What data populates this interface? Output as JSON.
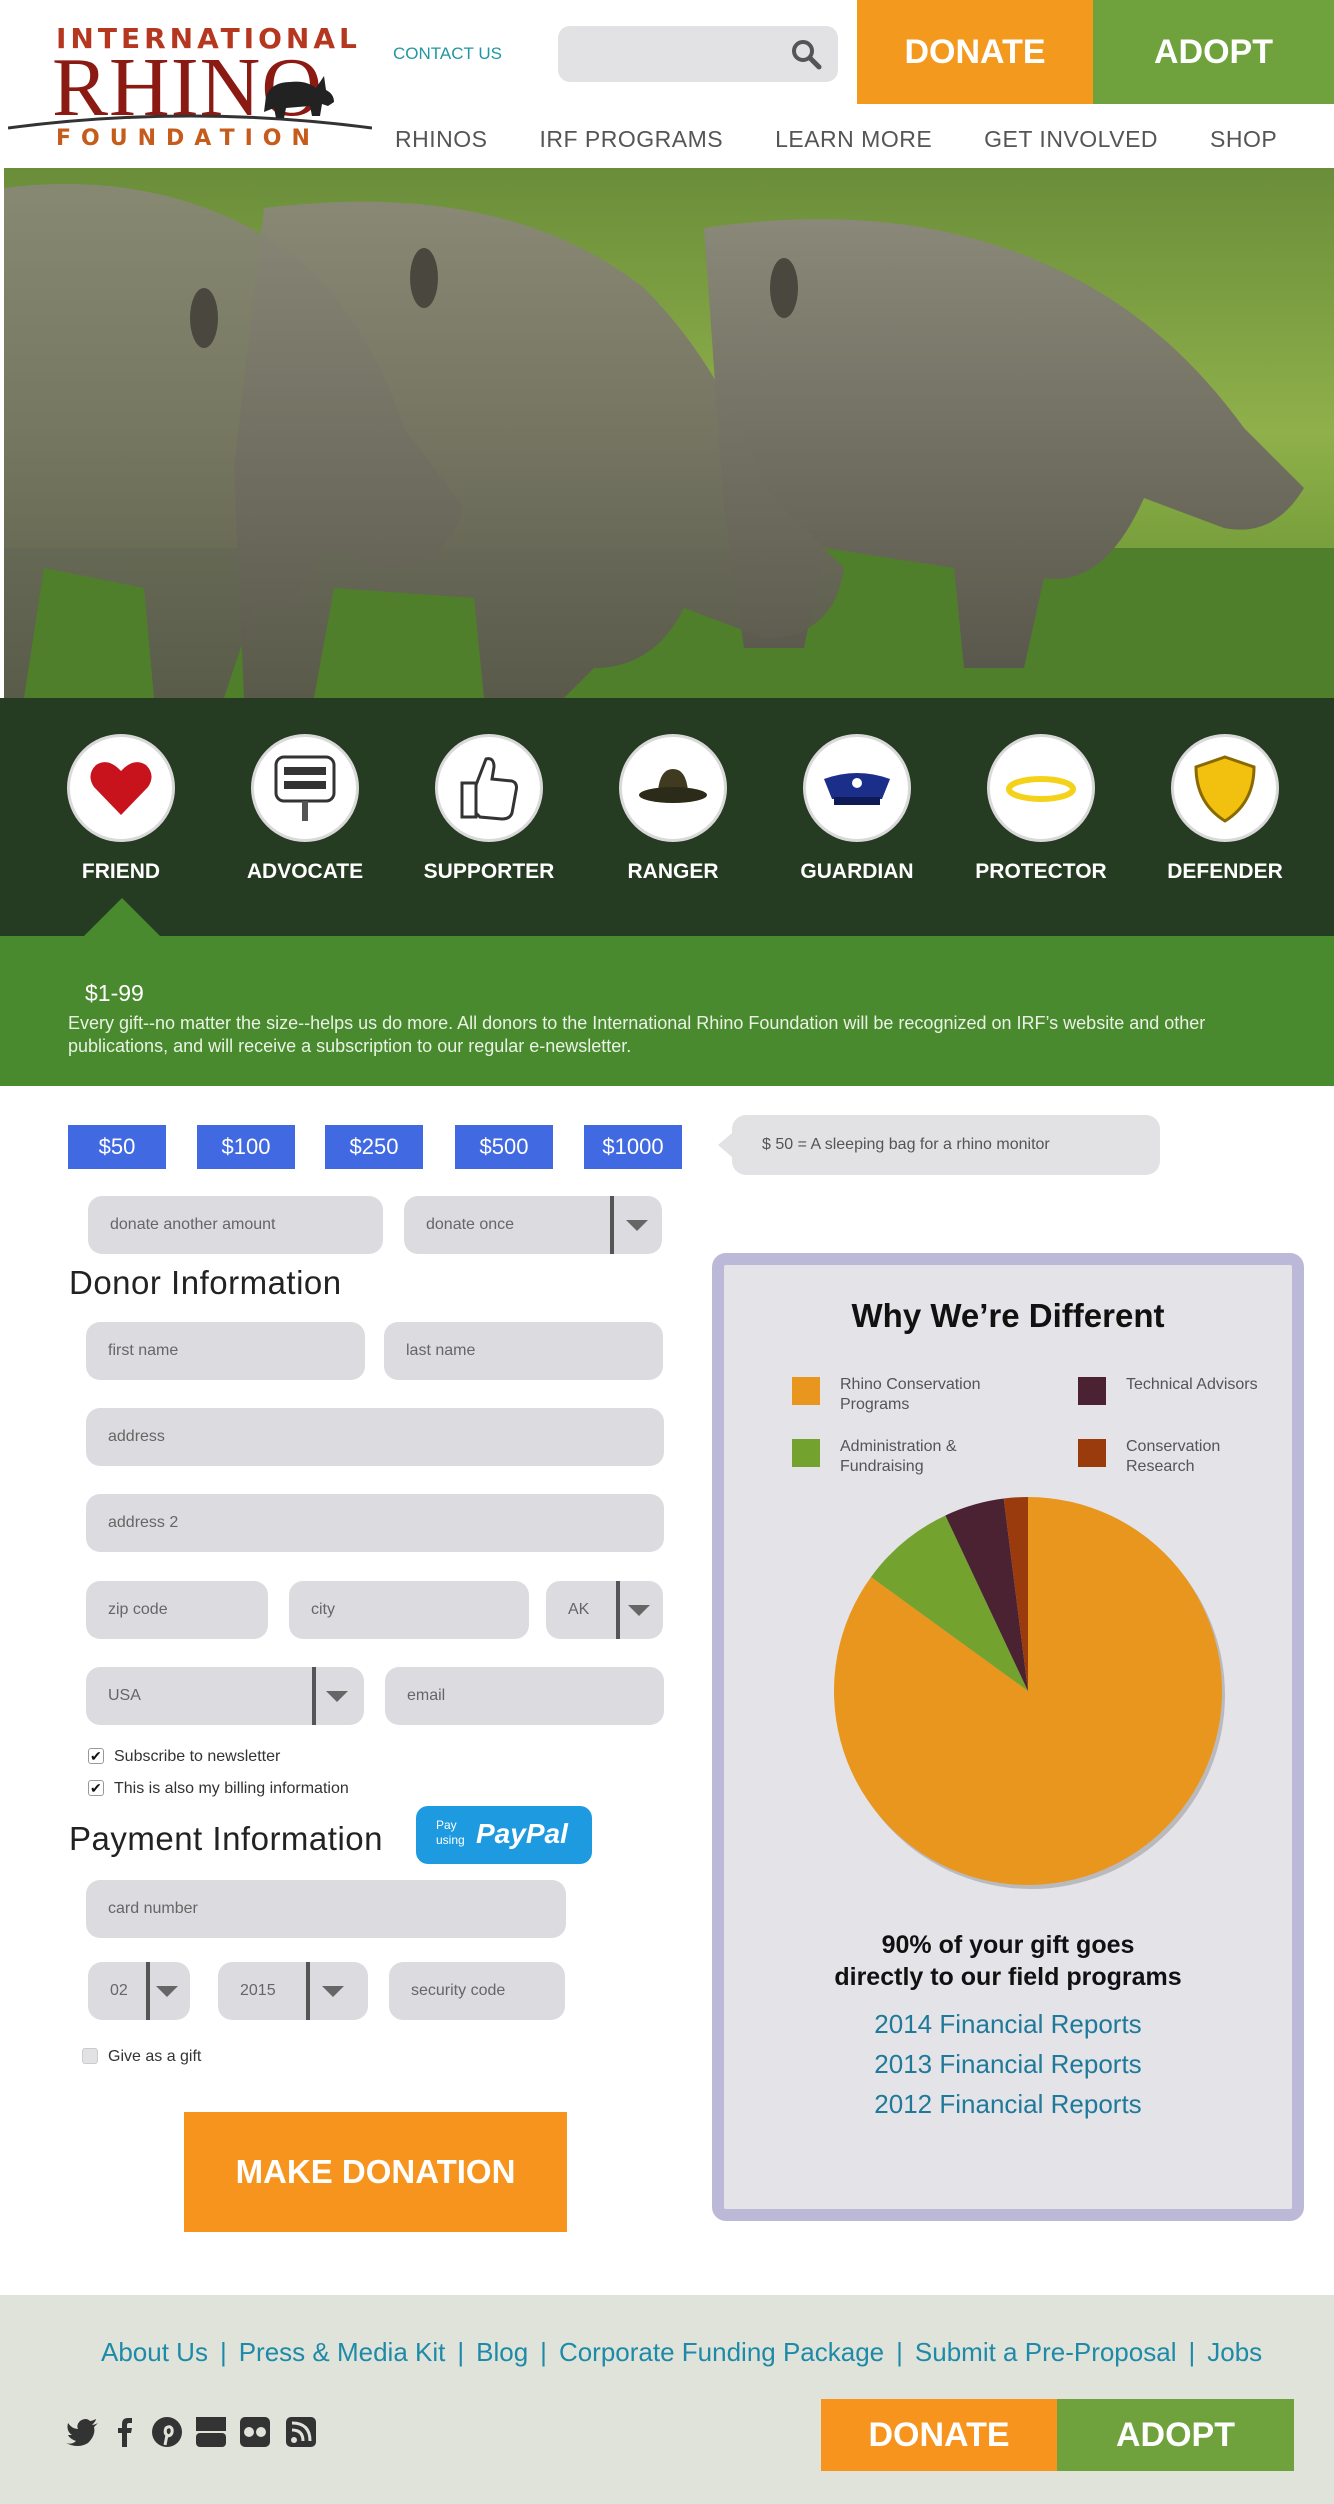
{
  "header": {
    "logo_top": "INTERNATIONAL",
    "logo_middle": "RHINO",
    "logo_bottom": "FOUNDATION",
    "contact": "CONTACT US",
    "donate": "DONATE",
    "adopt": "ADOPT",
    "nav": [
      "RHINOS",
      "IRF PROGRAMS",
      "LEARN MORE",
      "GET INVOLVED",
      "SHOP"
    ]
  },
  "tiers": [
    {
      "label": "FRIEND",
      "icon": "heart-icon"
    },
    {
      "label": "ADVOCATE",
      "icon": "save-the-rhinos-sign-icon"
    },
    {
      "label": "SUPPORTER",
      "icon": "thumbs-up-icon"
    },
    {
      "label": "RANGER",
      "icon": "ranger-hat-icon"
    },
    {
      "label": "GUARDIAN",
      "icon": "guardian-cap-icon"
    },
    {
      "label": "PROTECTOR",
      "icon": "halo-icon"
    },
    {
      "label": "DEFENDER",
      "icon": "shield-icon"
    }
  ],
  "selected_tier": {
    "amount": "$1-99",
    "description": "Every gift--no matter the size--helps us do more. All donors to the International Rhino Foundation will be recognized on IRF’s website and other publications, and will receive a subscription to our regular e-newsletter."
  },
  "amounts": [
    "$50",
    "$100",
    "$250",
    "$500",
    "$1000"
  ],
  "amount_tip": "$ 50 = A sleeping bag for a rhino monitor",
  "donation": {
    "other_amount_placeholder": "donate another amount",
    "frequency": "donate once"
  },
  "donor": {
    "heading": "Donor Information",
    "first_name": "first name",
    "last_name": "last name",
    "address": "address",
    "address2": "address 2",
    "zip": "zip code",
    "city": "city",
    "state": "AK",
    "country": "USA",
    "email": "email",
    "newsletter": "Subscribe to newsletter",
    "billing": "This is also my billing information"
  },
  "payment": {
    "heading": "Payment Information",
    "paypal_pay": "Pay",
    "paypal_using": "using",
    "paypal_brand": "PayPal",
    "card_number": "card number",
    "month": "02",
    "year": "2015",
    "security_code": "security code",
    "gift": "Give as a gift",
    "submit": "MAKE DONATION"
  },
  "why": {
    "title": "Why We’re Different",
    "legend": [
      {
        "label": "Rhino Conservation Programs",
        "color": "#e8961e"
      },
      {
        "label": "Technical Advisors",
        "color": "#4a2231"
      },
      {
        "label": "Administration & Fundraising",
        "color": "#74a22f"
      },
      {
        "label": "Conservation Research",
        "color": "#9a3b0e"
      }
    ],
    "stat_line1": "90% of your gift goes",
    "stat_line2": "directly to our field programs",
    "reports": [
      "2014 Financial Reports",
      "2013 Financial Reports",
      "2012 Financial Reports"
    ]
  },
  "chart_data": {
    "type": "pie",
    "title": "Why We’re Different",
    "slices": [
      {
        "label": "Rhino Conservation Programs",
        "value": 85,
        "color": "#e8961e"
      },
      {
        "label": "Administration & Fundraising",
        "value": 8,
        "color": "#74a22f"
      },
      {
        "label": "Technical Advisors",
        "value": 5,
        "color": "#4a2231"
      },
      {
        "label": "Conservation Research",
        "value": 2,
        "color": "#9a3b0e"
      }
    ],
    "legend_position": "top"
  },
  "footer": {
    "links": [
      "About Us",
      "Press & Media Kit",
      "Blog",
      "Corporate Funding Package",
      "Submit a Pre-Proposal",
      "Jobs"
    ],
    "social": [
      "twitter-icon",
      "facebook-icon",
      "pinterest-icon",
      "youtube-icon",
      "flickr-icon",
      "rss-icon"
    ],
    "donate": "DONATE",
    "adopt": "ADOPT"
  }
}
